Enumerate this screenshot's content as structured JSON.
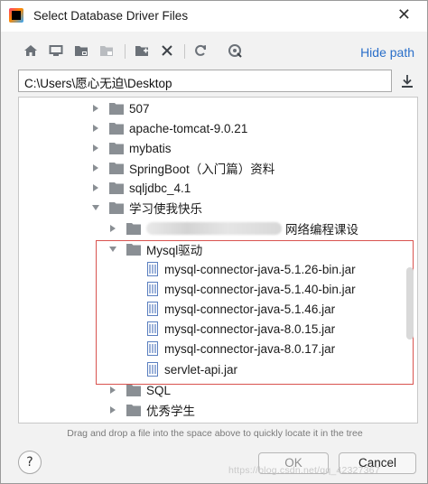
{
  "window": {
    "title": "Select Database Driver Files",
    "close_glyph": "✕"
  },
  "toolbar": {
    "icons": [
      "home-icon",
      "desktop-icon",
      "project-folder-icon",
      "module-folder-icon",
      "new-folder-icon",
      "delete-icon",
      "refresh-icon",
      "show-hidden-icon"
    ],
    "hide_path_label": "Hide path"
  },
  "path": {
    "value": "C:\\Users\\愿心无迫\\Desktop"
  },
  "tree": {
    "items": [
      {
        "label": "507",
        "type": "folder",
        "expanded": false
      },
      {
        "label": "apache-tomcat-9.0.21",
        "type": "folder",
        "expanded": false
      },
      {
        "label": "mybatis",
        "type": "folder",
        "expanded": false
      },
      {
        "label": "SpringBoot（入门篇）资料",
        "type": "folder",
        "expanded": false
      },
      {
        "label": "sqljdbc_4.1",
        "type": "folder",
        "expanded": false
      },
      {
        "label": "学习使我快乐",
        "type": "folder",
        "expanded": true
      },
      {
        "label": "网络编程课设",
        "type": "folder",
        "expanded": false,
        "partially_obscured": true
      },
      {
        "label": "Mysql驱动",
        "type": "folder",
        "expanded": true
      },
      {
        "label": "mysql-connector-java-5.1.26-bin.jar",
        "type": "jar"
      },
      {
        "label": "mysql-connector-java-5.1.40-bin.jar",
        "type": "jar"
      },
      {
        "label": "mysql-connector-java-5.1.46.jar",
        "type": "jar"
      },
      {
        "label": "mysql-connector-java-8.0.15.jar",
        "type": "jar"
      },
      {
        "label": "mysql-connector-java-8.0.17.jar",
        "type": "jar"
      },
      {
        "label": "servlet-api.jar",
        "type": "jar"
      },
      {
        "label": "SQL",
        "type": "folder",
        "expanded": false
      },
      {
        "label": "优秀学生",
        "type": "folder",
        "expanded": false
      }
    ]
  },
  "hint": "Drag and drop a file into the space above to quickly locate it in the tree",
  "buttons": {
    "help": "?",
    "ok": "OK",
    "cancel": "Cancel"
  },
  "watermark": "https://blog.csdn.net/qq_42327367",
  "colors": {
    "accent_link": "#2a6fc9",
    "highlight_border": "#d9534f",
    "folder": "#8a8f94",
    "jar": "#5a7fc0"
  }
}
